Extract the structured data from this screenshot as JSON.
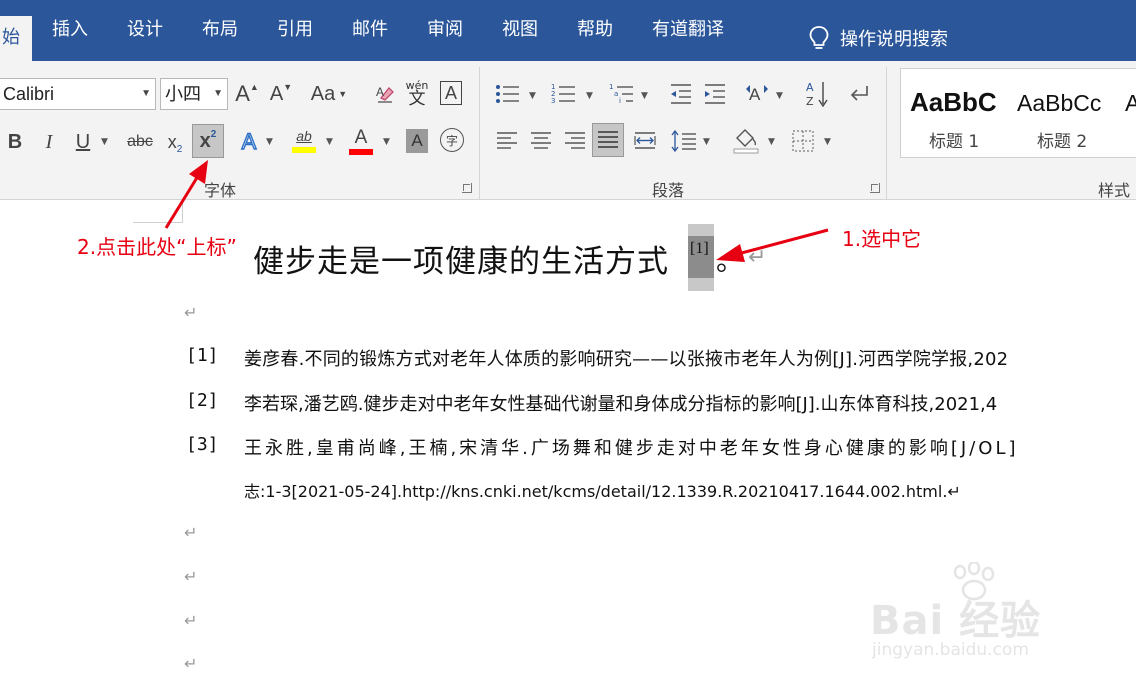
{
  "menu": {
    "tabs": [
      "始",
      "插入",
      "设计",
      "布局",
      "引用",
      "邮件",
      "审阅",
      "视图",
      "帮助",
      "有道翻译"
    ],
    "search_label": "操作说明搜索"
  },
  "ribbon": {
    "font_name": "Calibri",
    "font_size": "小四",
    "group_font_label": "字体",
    "group_paragraph_label": "段落",
    "group_styles_label": "样式",
    "grow_font": "A",
    "shrink_font": "A",
    "change_case": "Aa",
    "phonetic_top": "wén",
    "phonetic_bottom": "文",
    "char_border": "A",
    "bold": "B",
    "italic": "I",
    "underline": "U",
    "strikethrough": "abc",
    "subscript": "x",
    "subscript_mark": "2",
    "superscript": "x",
    "superscript_mark": "2",
    "text_effects": "A",
    "highlight": "ab",
    "font_color": "A",
    "char_shading": "A",
    "enclose_char": "字",
    "styles": [
      {
        "sample": "AaBbC",
        "name": "标题 1"
      },
      {
        "sample": "AaBbCc",
        "name": "标题 2"
      },
      {
        "sample": "A",
        "name": ""
      }
    ],
    "colors": {
      "highlight": "#ffff00",
      "font_color": "#ff0000",
      "accent": "#2b579a"
    }
  },
  "document": {
    "heading": "健步走是一项健康的生活方式",
    "citation": "[1]",
    "heading_end": "。",
    "return_mark": "↵",
    "references": [
      {
        "num": "[1]",
        "text": "姜彦春.不同的锻炼方式对老年人体质的影响研究——以张掖市老年人为例[J].河西学院学报,202"
      },
      {
        "num": "[2]",
        "text": "李若琛,潘艺鸥.健步走对中老年女性基础代谢量和身体成分指标的影响[J].山东体育科技,2021,4"
      },
      {
        "num": "[3]",
        "text": "王永胜,皇甫尚峰,王楠,宋清华.广场舞和健步走对中老年女性身心健康的影响[J/OL]"
      }
    ],
    "reference_3_cont": "志:1-3[2021-05-24].http://kns.cnki.net/kcms/detail/12.1339.R.20210417.1644.002.html.↵"
  },
  "annotations": {
    "step1": "1.选中它",
    "step2": "2.点击此处“上标”"
  },
  "watermark": {
    "logo": "Bai 经验",
    "url": "jingyan.baidu.com"
  }
}
